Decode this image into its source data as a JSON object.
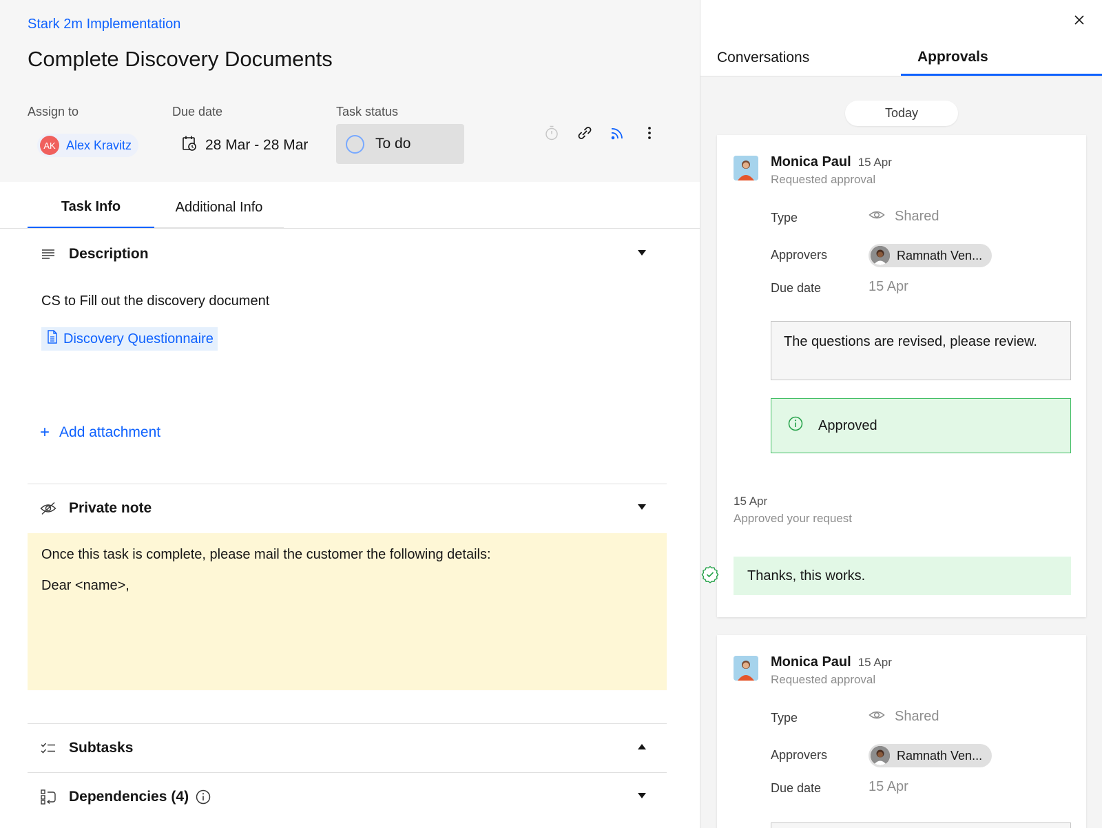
{
  "breadcrumb": "Stark 2m Implementation",
  "title": "Complete Discovery Documents",
  "meta": {
    "assign_label": "Assign to",
    "assignee_initials": "AK",
    "assignee_name": "Alex Kravitz",
    "due_label": "Due date",
    "due_value": "28 Mar - 28 Mar",
    "status_label": "Task status",
    "status_value": "To do"
  },
  "toolbar": {
    "icons": [
      "timer-icon",
      "link-icon",
      "feed-icon",
      "overflow-menu-icon"
    ]
  },
  "tabs_left": [
    {
      "label": "Task Info",
      "active": true
    },
    {
      "label": "Additional Info",
      "active": false
    }
  ],
  "description": {
    "title": "Description",
    "text": "CS to Fill out the discovery document",
    "doc_link": "Discovery Questionnaire",
    "add_attachment": "Add attachment"
  },
  "private_note": {
    "title": "Private note",
    "line1": "Once this task is complete, please mail the customer the following details:",
    "line2": "Dear <name>,"
  },
  "subtasks": {
    "title": "Subtasks"
  },
  "dependencies": {
    "title": "Dependencies",
    "count": "(4)"
  },
  "right": {
    "tabs": [
      {
        "label": "Conversations",
        "active": false
      },
      {
        "label": "Approvals",
        "active": true
      }
    ],
    "today": "Today",
    "cards": [
      {
        "name": "Monica Paul",
        "date": "15 Apr",
        "subtitle": "Requested approval",
        "type_label": "Type",
        "type_value": "Shared",
        "approvers_label": "Approvers",
        "approver": "Ramnath Ven...",
        "due_label": "Due date",
        "due_value": "15 Apr",
        "comment": "The questions are revised, please review.",
        "approved": "Approved",
        "response_date": "15 Apr",
        "response_sub": "Approved your request",
        "response_text": "Thanks, this works."
      },
      {
        "name": "Monica Paul",
        "date": "15 Apr",
        "subtitle": "Requested approval",
        "type_label": "Type",
        "type_value": "Shared",
        "approvers_label": "Approvers",
        "approver": "Ramnath Ven...",
        "due_label": "Due date",
        "due_value": "15 Apr"
      }
    ]
  },
  "colors": {
    "accent": "#0f62fe",
    "note_bg": "#fef7d6",
    "approved_bg": "#e2f8e6",
    "approved_border": "#42be65",
    "avatar_ak": "#f0605d"
  }
}
